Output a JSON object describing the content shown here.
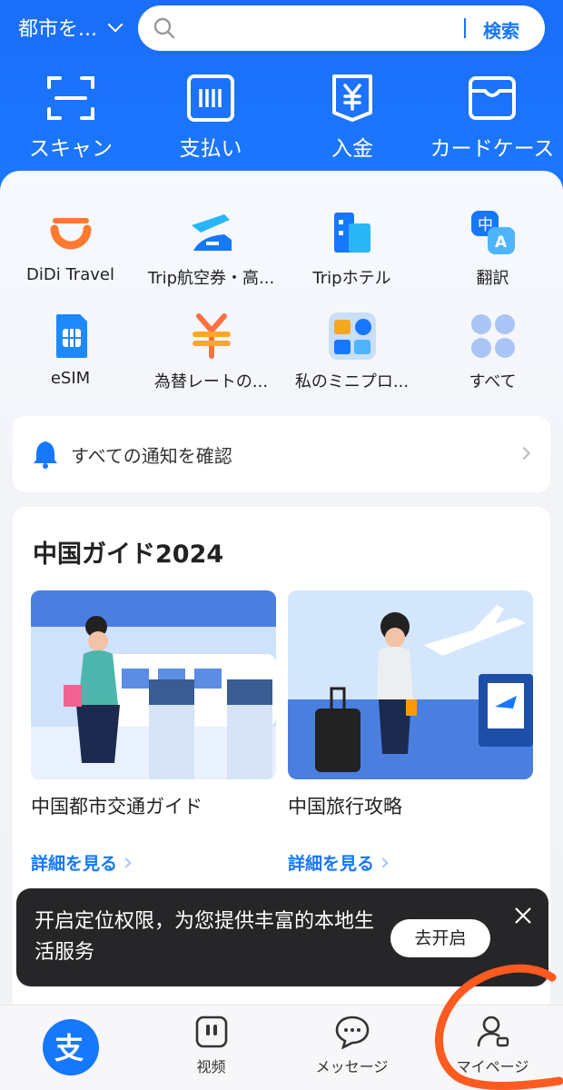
{
  "header": {
    "city": "都市を...",
    "search_placeholder": "",
    "search_button": "検索"
  },
  "quick_actions": [
    {
      "label": "スキャン",
      "icon": "scan-icon"
    },
    {
      "label": "支払い",
      "icon": "pay-barcode-icon"
    },
    {
      "label": "入金",
      "icon": "yen-topup-icon"
    },
    {
      "label": "カードケース",
      "icon": "wallet-card-icon"
    }
  ],
  "apps": [
    {
      "label": "DiDi Travel",
      "icon": "didi-icon"
    },
    {
      "label": "Trip航空券・高...",
      "icon": "trip-flight-icon"
    },
    {
      "label": "Tripホテル",
      "icon": "trip-hotel-icon"
    },
    {
      "label": "翻訳",
      "icon": "translate-icon"
    },
    {
      "label": "eSIM",
      "icon": "esim-icon"
    },
    {
      "label": "為替レートの...",
      "icon": "exchange-rate-icon"
    },
    {
      "label": "私のミニプロ...",
      "icon": "mini-program-icon"
    },
    {
      "label": "すべて",
      "icon": "all-apps-icon"
    }
  ],
  "notice": {
    "text": "すべての通知を確認",
    "icon": "bell-icon"
  },
  "guide": {
    "title": "中国ガイド2024",
    "cards": [
      {
        "title": "中国都市交通ガイド",
        "link": "詳細を見る"
      },
      {
        "title": "中国旅行攻略",
        "link": "詳細を見る"
      }
    ]
  },
  "toast": {
    "message": "开启定位权限，为您提供丰富的本地生活服务",
    "action": "去开启"
  },
  "bottom_nav": [
    {
      "label": "",
      "icon": "alipay-logo-icon"
    },
    {
      "label": "视频",
      "icon": "video-icon"
    },
    {
      "label": "メッセージ",
      "icon": "message-icon"
    },
    {
      "label": "マイページ",
      "icon": "profile-icon"
    }
  ],
  "colors": {
    "brand_blue": "#1677ff",
    "annotation_orange": "#ff5a1f"
  }
}
